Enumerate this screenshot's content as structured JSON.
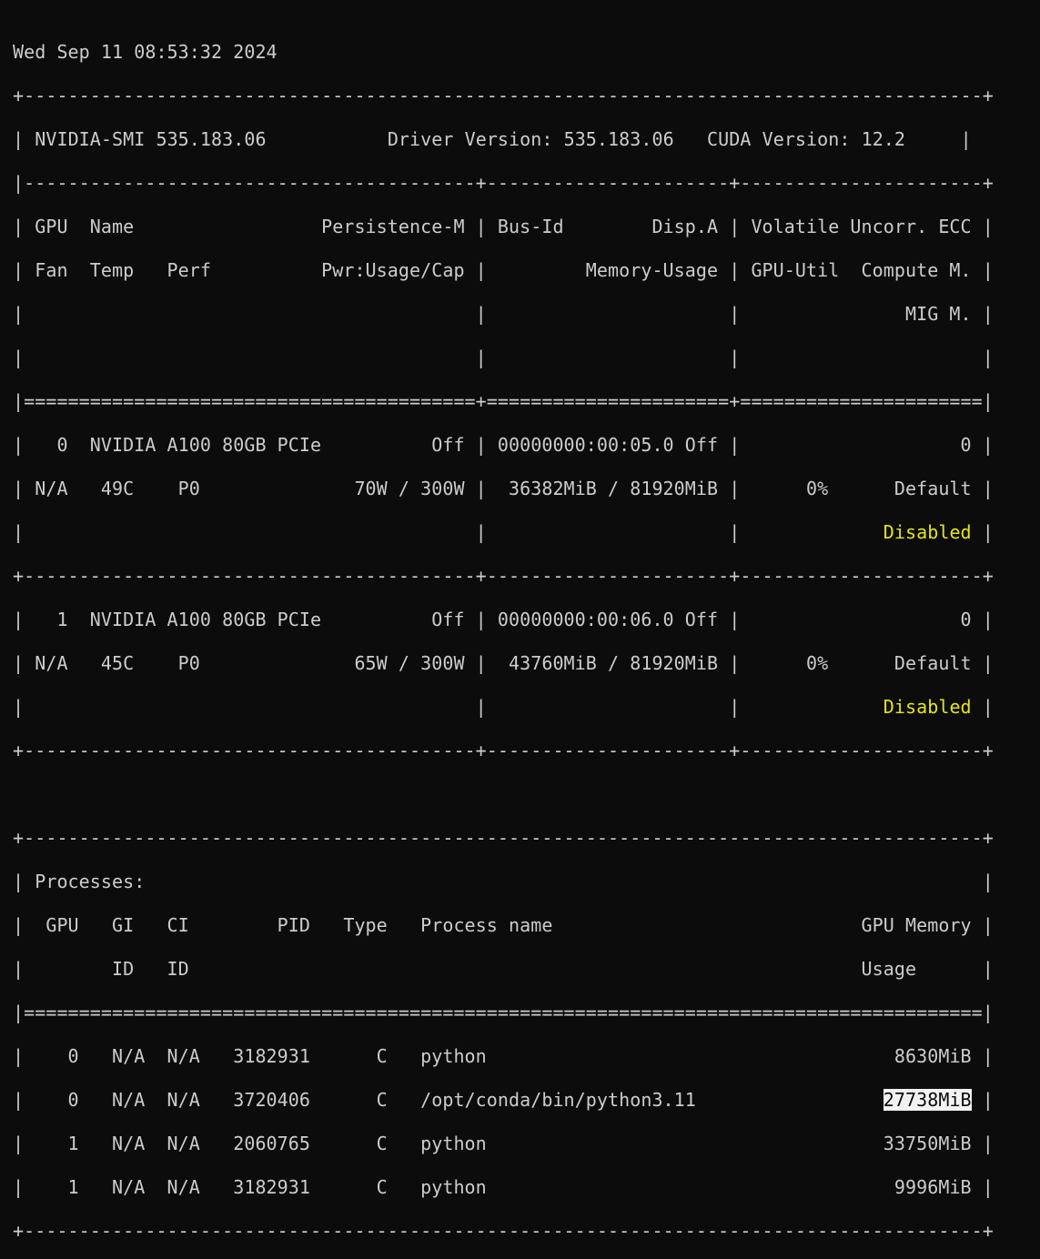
{
  "timestamp": "Wed Sep 11 08:53:32 2024",
  "header": {
    "smi_version": "NVIDIA-SMI 535.183.06",
    "driver_version": "Driver Version: 535.183.06",
    "cuda_version": "CUDA Version: 12.2"
  },
  "gpu_table_header": {
    "line1": "| GPU  Name                 Persistence-M | Bus-Id        Disp.A | Volatile Uncorr. ECC |",
    "line2": "| Fan  Temp   Perf          Pwr:Usage/Cap |         Memory-Usage | GPU-Util  Compute M. |",
    "line3": "|                                         |                      |               MIG M. |"
  },
  "gpus": [
    {
      "row1": "|   0  NVIDIA A100 80GB PCIe          Off | 00000000:00:05.0 Off |                    0 |",
      "row2": "| N/A   49C    P0              70W / 300W |  36382MiB / 81920MiB |      0%      Default |",
      "row3_lead": "|                                         |                      |             ",
      "mig": "Disabled",
      "row3_tail": " |"
    },
    {
      "row1": "|   1  NVIDIA A100 80GB PCIe          Off | 00000000:00:06.0 Off |                    0 |",
      "row2": "| N/A   45C    P0              65W / 300W |  43760MiB / 81920MiB |      0%      Default |",
      "row3_lead": "|                                         |                      |             ",
      "mig": "Disabled",
      "row3_tail": " |"
    }
  ],
  "processes": {
    "title": "| Processes:                                                                            |",
    "header1": "|  GPU   GI   CI        PID   Type   Process name                            GPU Memory |",
    "header2": "|        ID   ID                                                             Usage      |",
    "rows": [
      {
        "lead": "|    0   N/A  N/A   3182931      C   python                                     ",
        "mem": "8630MiB",
        "tail": " |"
      },
      {
        "lead": "|    0   N/A  N/A   3720406      C   /opt/conda/bin/python3.11                 ",
        "mem": "27738MiB",
        "tail": " |"
      },
      {
        "lead": "|    1   N/A  N/A   2060765      C   python                                    ",
        "mem": "33750MiB",
        "tail": " |"
      },
      {
        "lead": "|    1   N/A  N/A   3182931      C   python                                     ",
        "mem": "9996MiB",
        "tail": " |"
      }
    ]
  },
  "borders": {
    "outer": "+---------------------------------------------------------------------------------------+",
    "sep_cols": "|-----------------------------------------+----------------------+----------------------+",
    "double_cols": "|=========================================+======================+======================|",
    "mid_cols": "+-----------------------------------------+----------------------+----------------------+",
    "double_full": "|=======================================================================================|"
  }
}
